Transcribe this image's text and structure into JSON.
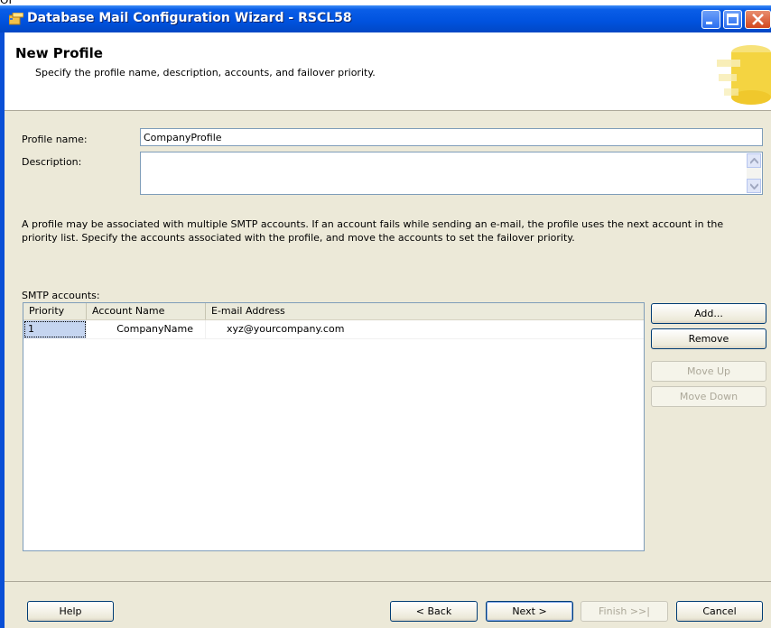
{
  "window": {
    "clipped_text": "OK",
    "title": "Database Mail Configuration Wizard - RSCL58"
  },
  "header": {
    "title": "New Profile",
    "subtitle": "Specify the profile name, description, accounts, and failover priority."
  },
  "form": {
    "profile_name_label": "Profile name:",
    "profile_name_value": "CompanyProfile",
    "description_label": "Description:",
    "description_value": ""
  },
  "info_text": "A profile may be associated with multiple SMTP accounts. If an account fails while sending an e-mail, the profile uses the next account in the priority list. Specify the accounts associated with the profile, and move the accounts to set the failover priority.",
  "smtp": {
    "label": "SMTP accounts:",
    "columns": [
      "Priority",
      "Account Name",
      "E-mail Address"
    ],
    "rows": [
      {
        "priority": "1",
        "account_name": "CompanyName",
        "email": "xyz@yourcompany.com"
      }
    ]
  },
  "side_buttons": {
    "add": "Add...",
    "remove": "Remove",
    "move_up": "Move Up",
    "move_down": "Move Down"
  },
  "footer": {
    "help": "Help",
    "back": "< Back",
    "next": "Next >",
    "finish": "Finish >>|",
    "cancel": "Cancel"
  },
  "colors": {
    "titlebar": "#0052de",
    "dialog_bg": "#ece9d8",
    "selection": "#c5d5f0"
  }
}
